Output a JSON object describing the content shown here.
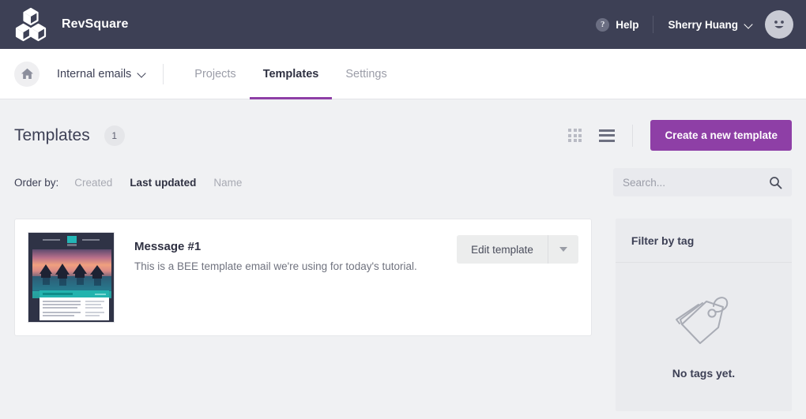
{
  "header": {
    "brand": "RevSquare",
    "help_label": "Help",
    "help_icon": "question-circle-icon",
    "user_name": "Sherry Huang",
    "user_chevron": "chevron-down-icon",
    "avatar_icon": "smiley-avatar-icon",
    "logo_icon": "cubes-logo-icon",
    "background_color": "#3d4055"
  },
  "nav": {
    "home_icon": "home-icon",
    "workspace": "Internal emails",
    "workspace_chevron": "chevron-down-icon",
    "tabs": [
      {
        "label": "Projects",
        "active": false
      },
      {
        "label": "Templates",
        "active": true
      },
      {
        "label": "Settings",
        "active": false
      }
    ],
    "active_underline_color": "#8e3fa6"
  },
  "page": {
    "title": "Templates",
    "count": "1",
    "view_grid_icon": "grid-view-icon",
    "view_list_icon": "list-view-icon",
    "create_button": "Create a new template",
    "create_button_color": "#8e3fa6"
  },
  "order_by": {
    "label": "Order by:",
    "options": [
      {
        "label": "Created",
        "active": false
      },
      {
        "label": "Last updated",
        "active": true
      },
      {
        "label": "Name",
        "active": false
      }
    ]
  },
  "search": {
    "placeholder": "Search...",
    "value": "",
    "icon": "search-icon"
  },
  "templates": [
    {
      "name": "Message #1",
      "description": "This is a BEE template email we're using for today's tutorial.",
      "thumbnail_alt": "email-template-thumbnail",
      "edit_label": "Edit template",
      "dropdown_icon": "caret-down-icon"
    }
  ],
  "tag_panel": {
    "title": "Filter by tag",
    "empty_icon": "tag-icon",
    "empty_text": "No tags yet."
  }
}
